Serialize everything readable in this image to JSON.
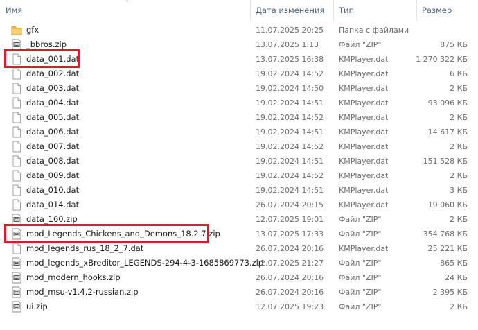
{
  "columns": {
    "name": "Имя",
    "date": "Дата изменения",
    "type": "Тип",
    "size": "Размер"
  },
  "files": [
    {
      "name": "gfx",
      "date": "11.07.2025 20:25",
      "type": "Папка с файлами",
      "size": "",
      "icon": "folder-icon"
    },
    {
      "name": "_bbros.zip",
      "date": "13.07.2025 1:13",
      "type": "Файл \"ZIP\"",
      "size": "875 КБ",
      "icon": "zip-file-icon"
    },
    {
      "name": "data_001.dat",
      "date": "13.07.2025 16:38",
      "type": "KMPlayer.dat",
      "size": "1 270 322 КБ",
      "icon": "file-icon"
    },
    {
      "name": "data_002.dat",
      "date": "19.02.2024 14:52",
      "type": "KMPlayer.dat",
      "size": "6 КБ",
      "icon": "file-icon"
    },
    {
      "name": "data_003.dat",
      "date": "19.02.2024 14:50",
      "type": "KMPlayer.dat",
      "size": "2 КБ",
      "icon": "file-icon"
    },
    {
      "name": "data_004.dat",
      "date": "19.02.2024 14:51",
      "type": "KMPlayer.dat",
      "size": "93 096 КБ",
      "icon": "file-icon"
    },
    {
      "name": "data_005.dat",
      "date": "19.02.2024 14:52",
      "type": "KMPlayer.dat",
      "size": "2 КБ",
      "icon": "file-icon"
    },
    {
      "name": "data_006.dat",
      "date": "19.02.2024 14:51",
      "type": "KMPlayer.dat",
      "size": "14 617 КБ",
      "icon": "file-icon"
    },
    {
      "name": "data_007.dat",
      "date": "19.02.2024 14:52",
      "type": "KMPlayer.dat",
      "size": "2 КБ",
      "icon": "file-icon"
    },
    {
      "name": "data_008.dat",
      "date": "19.02.2024 14:51",
      "type": "KMPlayer.dat",
      "size": "151 528 КБ",
      "icon": "file-icon"
    },
    {
      "name": "data_009.dat",
      "date": "19.02.2024 14:52",
      "type": "KMPlayer.dat",
      "size": "2 КБ",
      "icon": "file-icon"
    },
    {
      "name": "data_010.dat",
      "date": "19.02.2024 14:51",
      "type": "KMPlayer.dat",
      "size": "3 КБ",
      "icon": "file-icon"
    },
    {
      "name": "data_014.dat",
      "date": "26.07.2024 20:15",
      "type": "KMPlayer.dat",
      "size": "19 060 КБ",
      "icon": "file-icon"
    },
    {
      "name": "data_160.zip",
      "date": "12.07.2025 19:01",
      "type": "Файл \"ZIP\"",
      "size": "2 КБ",
      "icon": "zip-file-icon"
    },
    {
      "name": "mod_Legends_Chickens_and_Demons_18.2.7.zip",
      "date": "13.07.2025 17:33",
      "type": "Файл \"ZIP\"",
      "size": "354 768 КБ",
      "icon": "zip-file-icon"
    },
    {
      "name": "mod_legends_rus_18_2_7.dat",
      "date": "26.07.2024 20:16",
      "type": "KMPlayer.dat",
      "size": "25 221 КБ",
      "icon": "file-icon"
    },
    {
      "name": "mod_legends_xBreditor_LEGENDS-294-4-3-1685869773.zip",
      "date": "12.07.2025 21:27",
      "type": "Файл \"ZIP\"",
      "size": "865 КБ",
      "icon": "zip-file-icon"
    },
    {
      "name": "mod_modern_hooks.zip",
      "date": "26.07.2024 20:16",
      "type": "Файл \"ZIP\"",
      "size": "24 КБ",
      "icon": "zip-file-icon"
    },
    {
      "name": "mod_msu-v1.4.2-russian.zip",
      "date": "26.07.2024 20:16",
      "type": "Файл \"ZIP\"",
      "size": "2 395 КБ",
      "icon": "zip-file-icon"
    },
    {
      "name": "ui.zip",
      "date": "12.07.2025 19:23",
      "type": "Файл \"ZIP\"",
      "size": "2 КБ",
      "icon": "zip-file-icon"
    }
  ],
  "highlight_color": "#e0192a"
}
